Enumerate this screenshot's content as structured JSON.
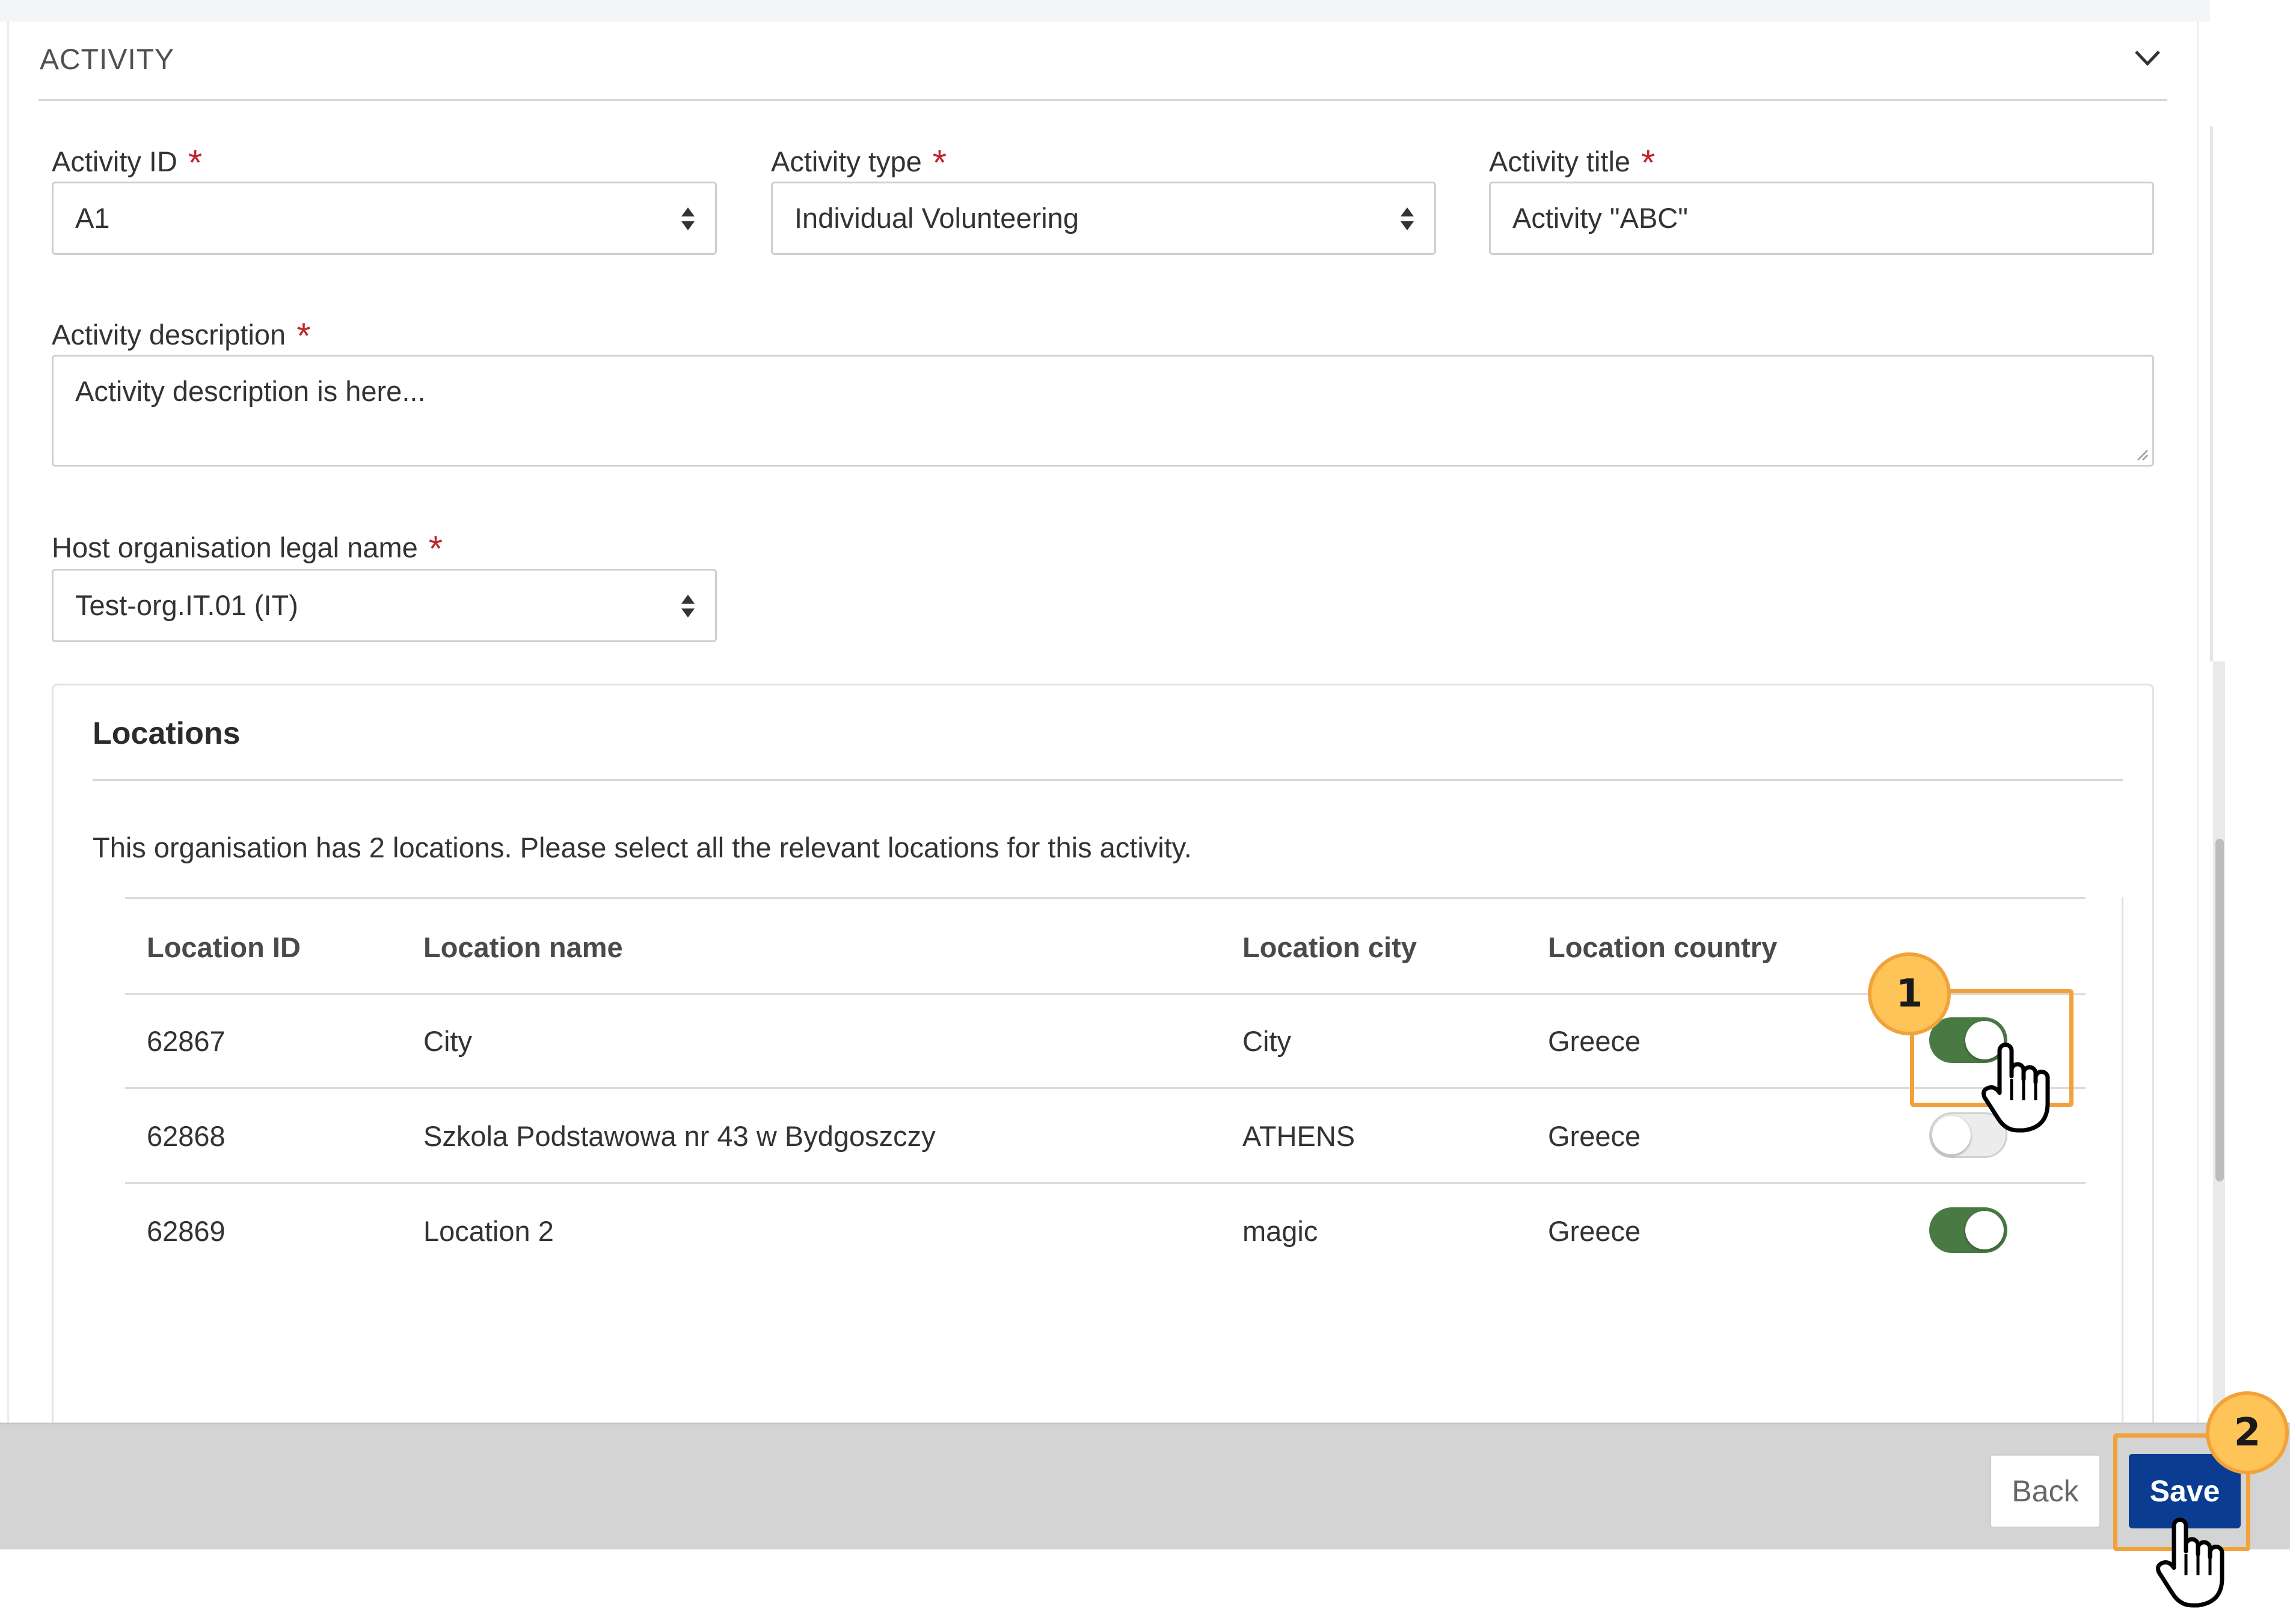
{
  "section": {
    "title": "ACTIVITY"
  },
  "fields": {
    "activity_id": {
      "label": "Activity ID",
      "value": "A1"
    },
    "activity_type": {
      "label": "Activity type",
      "value": "Individual Volunteering"
    },
    "activity_title": {
      "label": "Activity title",
      "value": "Activity \"ABC\""
    },
    "activity_description": {
      "label": "Activity description",
      "value": "Activity description is here..."
    },
    "host_org": {
      "label": "Host organisation legal name",
      "value": "Test-org.IT.01 (IT)"
    },
    "required_mark": "*"
  },
  "locations": {
    "title": "Locations",
    "description": "This organisation has 2 locations. Please select all the relevant locations for this activity.",
    "columns": [
      "Location ID",
      "Location name",
      "Location city",
      "Location country"
    ],
    "rows": [
      {
        "id": "62867",
        "name": "City",
        "city": "City",
        "country": "Greece",
        "selected": true
      },
      {
        "id": "62868",
        "name": "Szkola Podstawowa nr 43 w Bydgoszczy",
        "city": "ATHENS",
        "country": "Greece",
        "selected": false
      },
      {
        "id": "62869",
        "name": "Location 2",
        "city": "magic",
        "country": "Greece",
        "selected": true
      }
    ]
  },
  "footer": {
    "back_label": "Back",
    "save_label": "Save"
  },
  "annotations": {
    "step1": "1",
    "step2": "2"
  },
  "colors": {
    "accent": "#0a3d91",
    "toggle_on": "#4a7a44",
    "highlight": "#f2a23a",
    "badge": "#ffc457",
    "required": "#c0262d"
  }
}
